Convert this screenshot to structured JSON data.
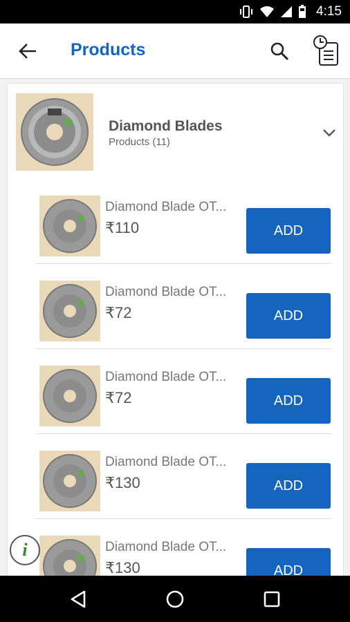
{
  "status_bar": {
    "time": "4:15",
    "icons": [
      "vibrate-icon",
      "wifi-icon",
      "signal-icon",
      "battery-icon"
    ]
  },
  "app_bar": {
    "title": "Products",
    "back_icon": "arrow-back-icon",
    "search_icon": "search-icon",
    "history_icon": "order-history-icon"
  },
  "category": {
    "name": "Diamond Blades",
    "count_label": "Products (11)",
    "expand_icon": "chevron-down-icon"
  },
  "products": [
    {
      "name": "Diamond Blade OT...",
      "price": "₹110",
      "button": "ADD"
    },
    {
      "name": "Diamond Blade OT...",
      "price": "₹72",
      "button": "ADD"
    },
    {
      "name": "Diamond Blade OT...",
      "price": "₹72",
      "button": "ADD"
    },
    {
      "name": "Diamond Blade OT...",
      "price": "₹130",
      "button": "ADD"
    },
    {
      "name": "Diamond Blade OT...",
      "price": "₹130",
      "button": "ADD"
    }
  ],
  "info_button": {
    "label": "i"
  },
  "colors": {
    "accent": "#1565c0",
    "status_bar": "#000000",
    "nav_bar": "#000000"
  }
}
